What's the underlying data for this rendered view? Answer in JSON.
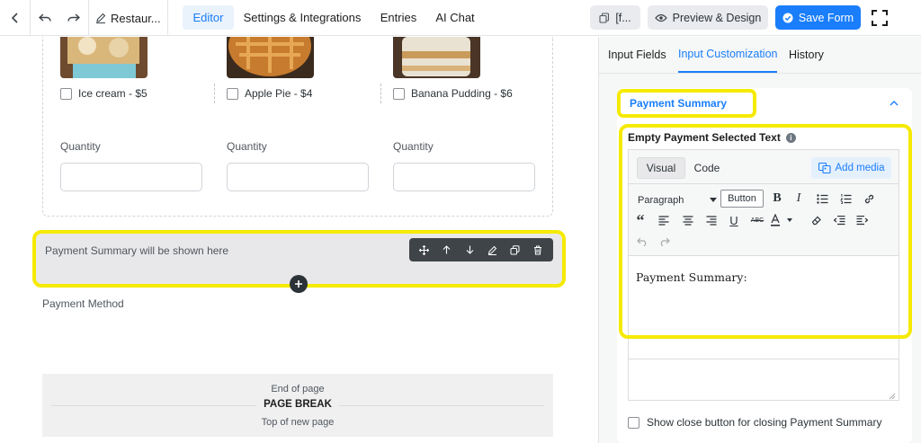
{
  "topbar": {
    "title": "Restaur...",
    "tabs": [
      "Editor",
      "Settings & Integrations",
      "Entries",
      "AI Chat"
    ],
    "shortcode_label": "[f...",
    "preview_label": "Preview & Design",
    "save_label": "Save Form"
  },
  "canvas": {
    "items": [
      {
        "label": "Ice cream - $5"
      },
      {
        "label": "Apple Pie - $4"
      },
      {
        "label": "Banana Pudding - $6"
      }
    ],
    "quantity_label": "Quantity",
    "payment_summary_placeholder": "Payment Summary will be shown here",
    "payment_method_label": "Payment Method",
    "page_break": {
      "end_text": "End of page",
      "title": "PAGE BREAK",
      "top_text": "Top of new page"
    }
  },
  "sidebar": {
    "tabs": [
      "Input Fields",
      "Input Customization",
      "History"
    ],
    "section_title": "Payment Summary",
    "field_label": "Empty Payment Selected Text",
    "editor": {
      "tab_visual": "Visual",
      "tab_code": "Code",
      "add_media": "Add media",
      "format_select": "Paragraph",
      "button_tool": "Button",
      "content": "Payment Summary:"
    },
    "close_option_label": "Show close button for closing Payment Summary"
  },
  "colors": {
    "accent": "#1a7efb",
    "highlight": "#f5ea00"
  }
}
